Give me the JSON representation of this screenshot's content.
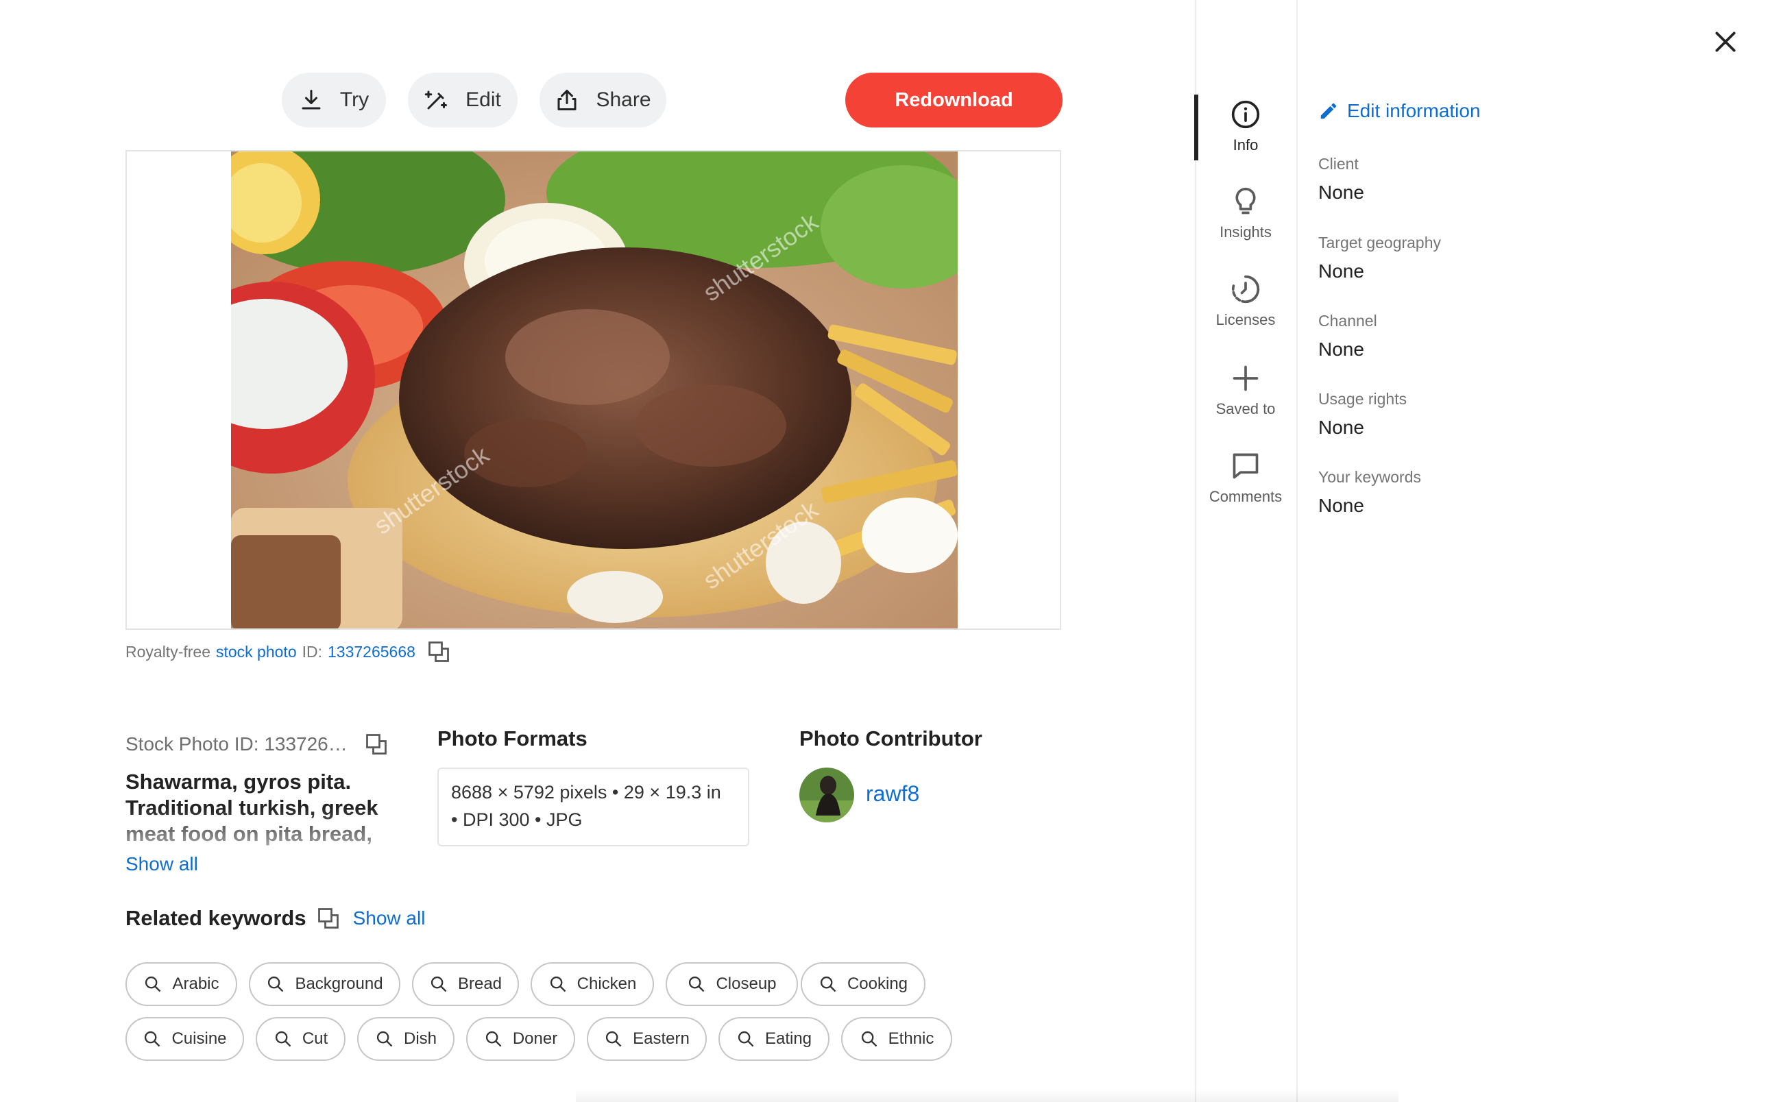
{
  "toolbar": {
    "try_label": "Try",
    "edit_label": "Edit",
    "share_label": "Share",
    "redownload_label": "Redownload"
  },
  "photo": {
    "watermark": "shutterstock",
    "caption_prefix": "Royalty-free",
    "caption_link": "stock photo",
    "caption_id_label": "ID:",
    "caption_id": "1337265668"
  },
  "details": {
    "stock_id": "Stock Photo ID: 133726…",
    "description": "Shawarma, gyros pita. Traditional turkish, greek meat food on pita bread,",
    "show_all": "Show all"
  },
  "formats": {
    "title": "Photo Formats",
    "line1": "8688 × 5792 pixels • 29 × 19.3 in",
    "line2": "• DPI 300 • JPG"
  },
  "contributor": {
    "title": "Photo Contributor",
    "name": "rawf8"
  },
  "keywords": {
    "title": "Related keywords",
    "show_all": "Show all",
    "row1": [
      "Arabic",
      "Background",
      "Bread",
      "Chicken",
      "Closeup",
      "Cooking"
    ],
    "row2": [
      "Cuisine",
      "Cut",
      "Dish",
      "Doner",
      "Eastern",
      "Eating",
      "Ethnic"
    ]
  },
  "rail": {
    "items": [
      {
        "label": "Info",
        "icon": "info-icon"
      },
      {
        "label": "Insights",
        "icon": "lightbulb-icon"
      },
      {
        "label": "Licenses",
        "icon": "history-icon"
      },
      {
        "label": "Saved to",
        "icon": "plus-icon"
      },
      {
        "label": "Comments",
        "icon": "comment-icon"
      }
    ]
  },
  "info_panel": {
    "edit_label": "Edit information",
    "fields": [
      {
        "label": "Client",
        "value": "None"
      },
      {
        "label": "Target geography",
        "value": "None"
      },
      {
        "label": "Channel",
        "value": "None"
      },
      {
        "label": "Usage rights",
        "value": "None"
      },
      {
        "label": "Your keywords",
        "value": "None"
      }
    ]
  },
  "colors": {
    "accent_red": "#f44336",
    "link_blue": "#0f6dd1"
  }
}
